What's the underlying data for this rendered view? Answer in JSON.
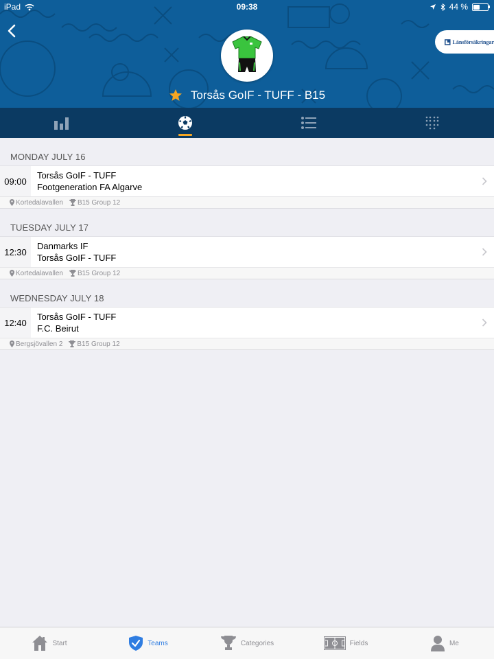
{
  "status_bar": {
    "device": "iPad",
    "time": "09:38",
    "battery": "44 %",
    "battery_level": 0.44
  },
  "header": {
    "team_title": "Torsås GoIF - TUFF - B15",
    "sponsor_text": "Länsförsäkringar",
    "background_color": "#0e5e9a",
    "favorite_star_color": "#f5a623"
  },
  "tabs": [
    {
      "icon": "bar-chart-icon"
    },
    {
      "icon": "soccer-ball-icon",
      "active": true
    },
    {
      "icon": "list-icon"
    },
    {
      "icon": "dot-grid-icon"
    }
  ],
  "schedule": [
    {
      "day": "MONDAY JULY 16",
      "matches": [
        {
          "time": "09:00",
          "home": "Torsås GoIF - TUFF",
          "away": "Footgeneration FA Algarve",
          "field": "Kortedalavallen",
          "group": "B15 Group 12"
        }
      ]
    },
    {
      "day": "TUESDAY JULY 17",
      "matches": [
        {
          "time": "12:30",
          "home": "Danmarks IF",
          "away": "Torsås GoIF - TUFF",
          "field": "Kortedalavallen",
          "group": "B15 Group 12"
        }
      ]
    },
    {
      "day": "WEDNESDAY JULY 18",
      "matches": [
        {
          "time": "12:40",
          "home": "Torsås GoIF - TUFF",
          "away": "F.C. Beirut",
          "field": "Bergsjövallen 2",
          "group": "B15 Group 12"
        }
      ]
    }
  ],
  "bottom_tabs": [
    {
      "label": "Start",
      "icon": "home-icon"
    },
    {
      "label": "Teams",
      "icon": "shield-check-icon",
      "active": true
    },
    {
      "label": "Categories",
      "icon": "trophy-icon"
    },
    {
      "label": "Fields",
      "icon": "field-icon"
    },
    {
      "label": "Me",
      "icon": "person-icon"
    }
  ],
  "colors": {
    "active_tab": "#2f7de1",
    "tab_indicator": "#f5a623",
    "tab_bar_bg": "#0b3a62"
  }
}
